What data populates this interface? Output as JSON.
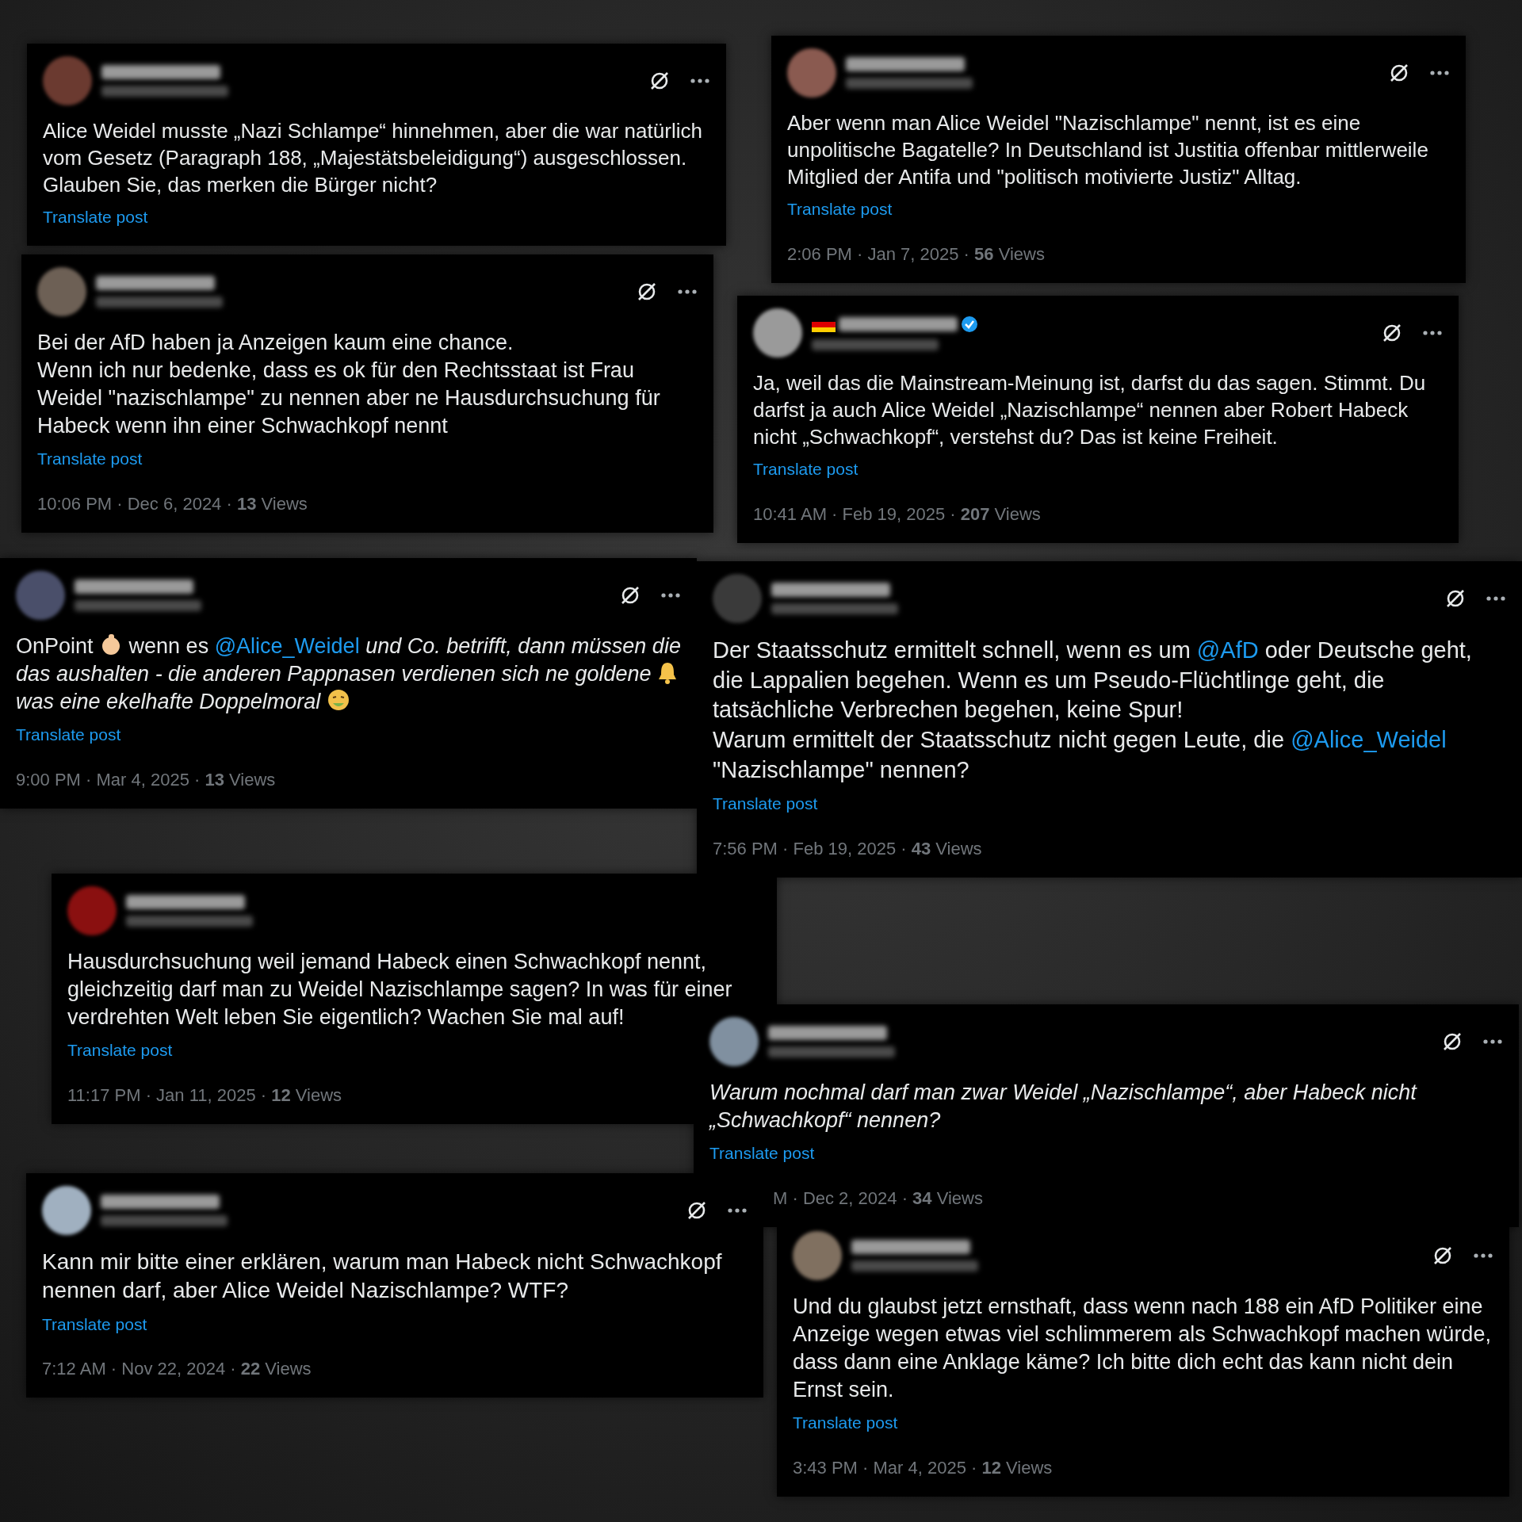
{
  "posts": [
    {
      "verified": false,
      "flag": false,
      "actions": true,
      "body": [
        {
          "kind": "text",
          "text": "Alice Weidel musste „Nazi Schlampe“ hinnehmen, aber die war natürlich vom Gesetz (Paragraph 188, „Majestätsbeleidigung“) ausgeschlossen. Glauben Sie, das merken die Bürger nicht?"
        }
      ],
      "translate": "Translate post"
    },
    {
      "verified": false,
      "flag": false,
      "actions": true,
      "body": [
        {
          "kind": "text",
          "text": "Aber wenn man Alice Weidel \"Nazischlampe\" nennt, ist es eine unpolitische Bagatelle? In Deutschland ist Justitia offenbar mittlerweile Mitglied der Antifa und \"politisch motivierte Justiz\" Alltag."
        }
      ],
      "translate": "Translate post",
      "meta": "2:06 PM · Jan 7, 2025 · **56** Views"
    },
    {
      "verified": false,
      "flag": false,
      "actions": true,
      "body": [
        {
          "kind": "text",
          "text": "Bei der AfD haben ja Anzeigen kaum eine chance.\nWenn ich nur bedenke, dass es ok für den Rechtsstaat ist Frau Weidel \"nazischlampe\" zu nennen aber ne Hausdurchsuchung für Habeck wenn ihn einer Schwachkopf nennt"
        }
      ],
      "translate": "Translate post",
      "meta": "10:06 PM · Dec 6, 2024 · **13** Views"
    },
    {
      "verified": true,
      "flag": true,
      "actions": true,
      "body": [
        {
          "kind": "text",
          "text": "Ja, weil das die Mainstream-Meinung ist, darfst du das sagen. Stimmt. Du darfst ja auch Alice Weidel „Nazischlampe“ nennen aber Robert Habeck nicht „Schwachkopf“, verstehst du? Das ist keine Freiheit."
        }
      ],
      "translate": "Translate post",
      "meta": "10:41 AM · Feb 19, 2025 · **207** Views"
    },
    {
      "verified": false,
      "flag": false,
      "actions": true,
      "body": [
        {
          "kind": "text",
          "text": "OnPoint "
        },
        {
          "kind": "thumb"
        },
        {
          "kind": "text",
          "text": " wenn es "
        },
        {
          "kind": "mention",
          "text": "@Alice_Weidel"
        },
        {
          "kind": "text",
          "text": " *und Co. betrifft, dann müssen die das aushalten - die anderen Pappnasen verdienen sich ne goldene* "
        },
        {
          "kind": "bell"
        },
        {
          "kind": "text",
          "text": " *was eine ekelhafte Doppelmoral* "
        },
        {
          "kind": "sick"
        }
      ],
      "translate": "Translate post",
      "meta": "9:00 PM · Mar 4, 2025 · **13** Views"
    },
    {
      "verified": false,
      "flag": false,
      "actions": true,
      "body": [
        {
          "kind": "text",
          "text": "Der Staatsschutz ermittelt schnell, wenn es um "
        },
        {
          "kind": "mention",
          "text": "@AfD"
        },
        {
          "kind": "text",
          "text": " oder Deutsche geht, die Lappalien begehen. Wenn es um Pseudo-Flüchtlinge geht, die tatsächliche Verbrechen begehen, keine Spur!\nWarum ermittelt der Staatsschutz nicht gegen Leute, die "
        },
        {
          "kind": "mention",
          "text": "@Alice_Weidel"
        },
        {
          "kind": "text",
          "text": " \"Nazischlampe\" nennen?"
        }
      ],
      "translate": "Translate post",
      "meta": "7:56 PM · Feb 19, 2025 · **43** Views"
    },
    {
      "verified": false,
      "flag": false,
      "actions": false,
      "body": [
        {
          "kind": "text",
          "text": "Hausdurchsuchung weil jemand Habeck einen Schwachkopf nennt, gleichzeitig darf man zu Weidel Nazischlampe sagen? In was für einer verdrehten Welt leben Sie eigentlich? Wachen Sie mal auf!"
        }
      ],
      "translate": "Translate post",
      "meta": "11:17 PM · Jan 11, 2025 · **12** Views"
    },
    {
      "verified": false,
      "flag": false,
      "actions": true,
      "body": [
        {
          "kind": "text",
          "text": "*Warum nochmal darf man zwar Weidel „Nazischlampe“, aber Habeck nicht „Schwachkopf“ nennen?*"
        }
      ],
      "translate": "Translate post",
      "meta": "M · Dec 2, 2024 · **34** Views"
    },
    {
      "verified": false,
      "flag": false,
      "actions": true,
      "body": [
        {
          "kind": "text",
          "text": "Kann mir bitte einer erklären, warum man Habeck nicht Schwachkopf nennen darf, aber Alice Weidel Nazischlampe? WTF?"
        }
      ],
      "translate": "Translate post",
      "meta": "7:12 AM · Nov 22, 2024 · **22** Views"
    },
    {
      "verified": false,
      "flag": false,
      "actions": true,
      "body": [
        {
          "kind": "text",
          "text": "Und du glaubst jetzt ernsthaft, dass wenn nach 188 ein AfD Politiker eine Anzeige wegen etwas viel schlimmerem als Schwachkopf machen würde, dass dann eine Anklage käme? Ich bitte dich echt das kann nicht dein Ernst sein."
        }
      ],
      "translate": "Translate post",
      "meta": "3:43 PM · Mar 4, 2025 · **12** Views"
    }
  ]
}
